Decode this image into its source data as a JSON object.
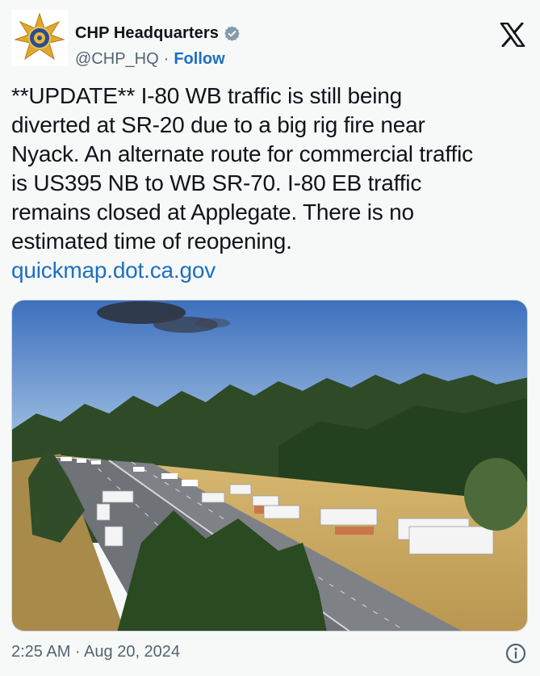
{
  "account": {
    "display_name": "CHP Headquarters",
    "handle": "@CHP_HQ",
    "separator": "·",
    "follow_label": "Follow",
    "avatar_icon": "chp-star-badge-icon",
    "verified_icon": "verified-badge-icon",
    "verified_color": "#829aab"
  },
  "platform": {
    "logo_icon": "x-logo-icon"
  },
  "tweet": {
    "text": "**UPDATE** I-80 WB traffic is still being\ndiverted at SR-20 due to a big rig fire near\nNyack. An alternate route for commercial traffic\nis US395 NB to WB SR-70. I-80 EB traffic\nremains closed at Applegate. There is no\nestimated time of reopening.",
    "link": "quickmap.dot.ca.gov",
    "link_color": "#1d6fc2"
  },
  "media": {
    "description_icon": "highway-camera-photo"
  },
  "footer": {
    "timestamp": "2:25 AM · Aug 20, 2024",
    "info_icon": "info-icon"
  }
}
